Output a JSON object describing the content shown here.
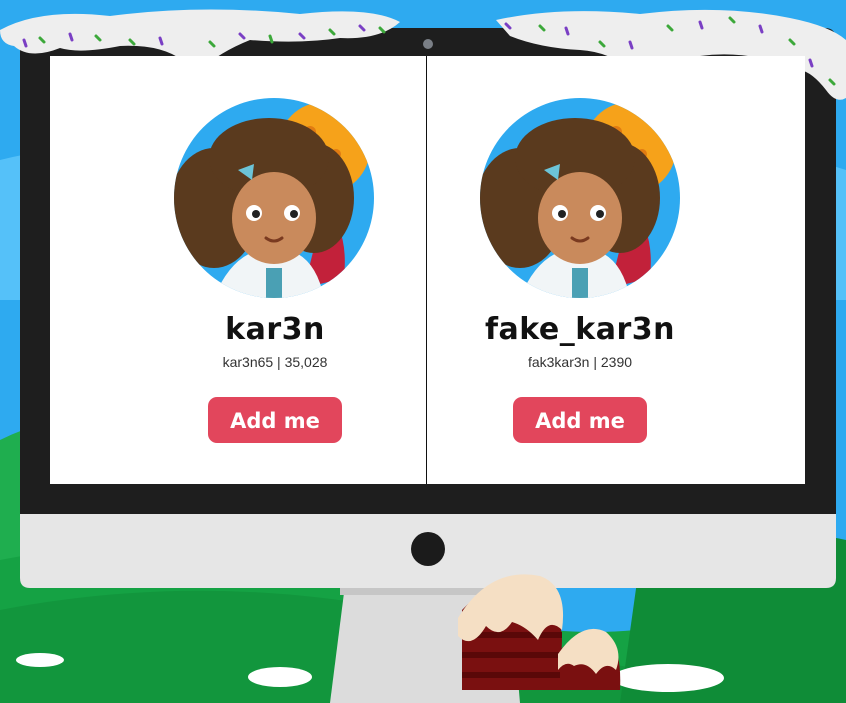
{
  "profiles": [
    {
      "display_name": "kar3n",
      "handle_line": "kar3n65 | 35,028",
      "button_label": "Add me"
    },
    {
      "display_name": "fake_kar3n",
      "handle_line": "fak3kar3n | 2390",
      "button_label": "Add me"
    }
  ],
  "colors": {
    "accent": "#e2465c",
    "sky": "#2eaaf0",
    "grass": "#17a447",
    "monitor_frame": "#1e1e1e",
    "monitor_chin": "#e6e6e6"
  }
}
